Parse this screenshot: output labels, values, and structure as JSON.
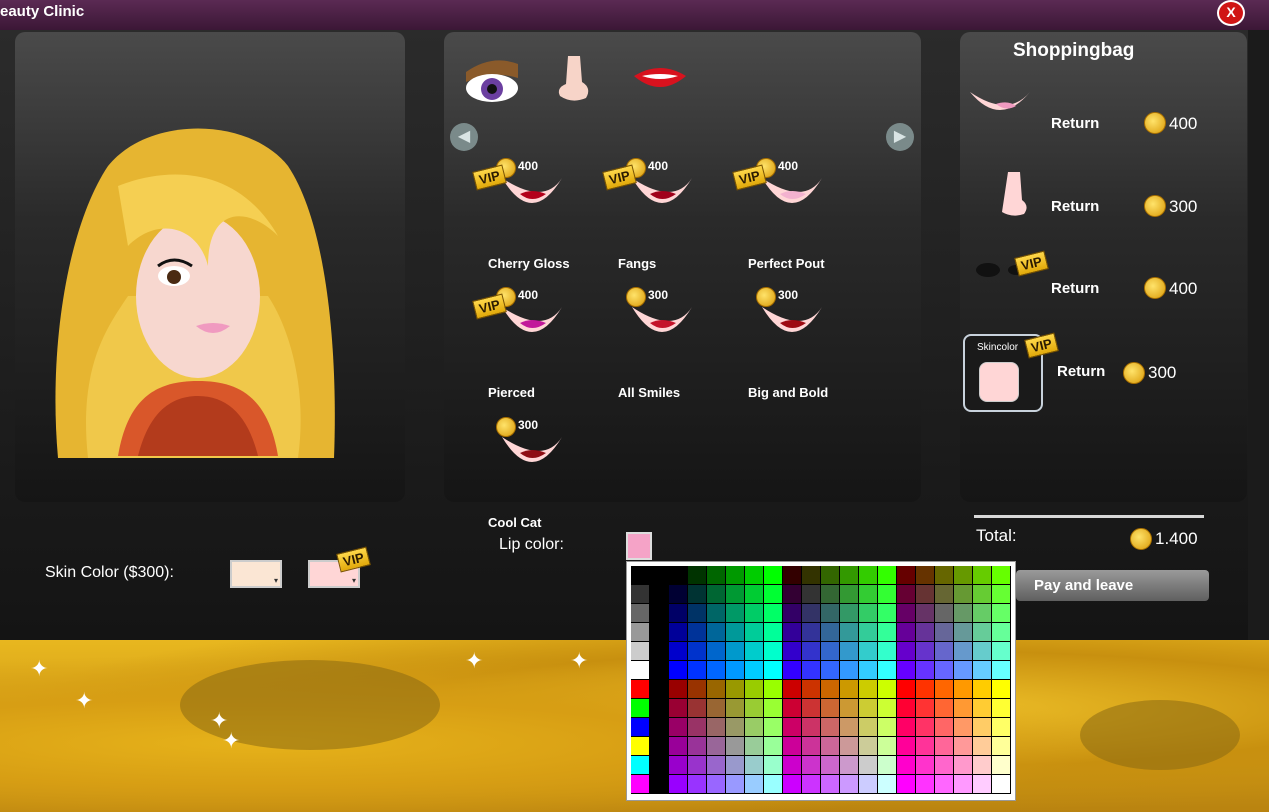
{
  "window": {
    "title": "eauty Clinic",
    "close_label": "X"
  },
  "tabs": [
    {
      "name": "eyes"
    },
    {
      "name": "nose"
    },
    {
      "name": "lips"
    }
  ],
  "items": [
    {
      "name": "Cherry Gloss",
      "price": "400",
      "vip": "VIP",
      "lip": "#b3001a"
    },
    {
      "name": "Fangs",
      "price": "400",
      "vip": "VIP",
      "lip": "#a0001a"
    },
    {
      "name": "Perfect Pout",
      "price": "400",
      "vip": "VIP",
      "lip": "#f3b2cf"
    },
    {
      "name": "Pierced",
      "price": "400",
      "vip": "VIP",
      "lip": "#c2199a"
    },
    {
      "name": "All Smiles",
      "price": "300",
      "vip": "",
      "lip": "#c4132a"
    },
    {
      "name": "Big and Bold",
      "price": "300",
      "vip": "",
      "lip": "#9e0a12"
    },
    {
      "name": "Cool Cat",
      "price": "300",
      "vip": "",
      "lip": "#8e0d14"
    }
  ],
  "skin": {
    "label": "Skin Color ($300):",
    "vip": "VIP",
    "color1": "#fbe6d4",
    "color2": "#ffd6d6"
  },
  "lip": {
    "label": "Lip color:",
    "color": "#f5a3c7"
  },
  "bag": {
    "title": "Shoppingbag",
    "rows": [
      {
        "action": "Return",
        "price": "400",
        "vip": ""
      },
      {
        "action": "Return",
        "price": "300",
        "vip": ""
      },
      {
        "action": "Return",
        "price": "400",
        "vip": "VIP"
      },
      {
        "action": "Return",
        "price": "300",
        "vip": "VIP",
        "label": "Skincolor"
      }
    ],
    "total_label": "Total:",
    "total_value": "1.400",
    "pay_label": "Pay and leave"
  }
}
